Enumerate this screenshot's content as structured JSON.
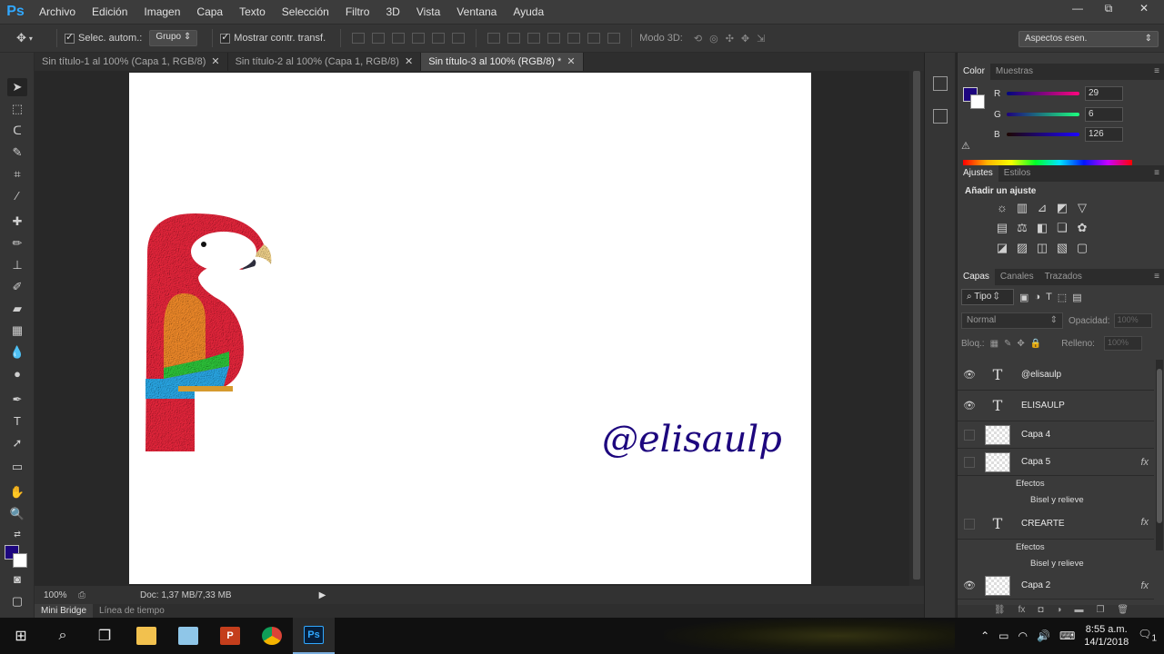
{
  "app": {
    "logo": "Ps"
  },
  "menu": [
    "Archivo",
    "Edición",
    "Imagen",
    "Capa",
    "Texto",
    "Selección",
    "Filtro",
    "3D",
    "Vista",
    "Ventana",
    "Ayuda"
  ],
  "window_controls": {
    "minimize": "—",
    "restore": "⧉",
    "close": "✕"
  },
  "options": {
    "auto_select_label": "Selec. autom.:",
    "auto_select_value": "Grupo",
    "show_transform_label": "Mostrar contr. transf.",
    "mode3d_label": "Modo 3D:",
    "workspace": "Aspectos esen."
  },
  "tabs": [
    {
      "label": "Sin título-1 al 100% (Capa 1, RGB/8)",
      "active": false
    },
    {
      "label": "Sin título-2 al 100% (Capa 1, RGB/8)",
      "active": false
    },
    {
      "label": "Sin título-3 al 100% (RGB/8) *",
      "active": true
    }
  ],
  "canvas": {
    "watermark_text": "@elisaulp",
    "text_color": "#1d067e"
  },
  "status": {
    "zoom": "100%",
    "doc_info": "Doc: 1,37 MB/7,33 MB"
  },
  "bottom_tabs": [
    "Mini Bridge",
    "Línea de tiempo"
  ],
  "color_panel": {
    "tabs": [
      "Color",
      "Muestras"
    ],
    "foreground": "#1d067e",
    "channels": [
      {
        "label": "R",
        "value": "29"
      },
      {
        "label": "G",
        "value": "6"
      },
      {
        "label": "B",
        "value": "126"
      }
    ]
  },
  "adjustments_panel": {
    "tabs": [
      "Ajustes",
      "Estilos"
    ],
    "title": "Añadir un ajuste"
  },
  "layers_panel": {
    "tabs": [
      "Capas",
      "Canales",
      "Trazados"
    ],
    "kind_filter": "Tipo",
    "blend_mode": "Normal",
    "opacity_label": "Opacidad:",
    "opacity_value": "100%",
    "lock_label": "Bloq.:",
    "fill_label": "Relleno:",
    "fill_value": "100%",
    "layers": [
      {
        "name": "@elisaulp",
        "type": "text",
        "visible": true
      },
      {
        "name": "ELISAULP",
        "type": "text",
        "visible": true
      },
      {
        "name": "Capa 4",
        "type": "image",
        "visible": false
      },
      {
        "name": "Capa 5",
        "type": "image",
        "visible": false,
        "fx": true,
        "effects_label": "Efectos",
        "effect": "Bisel y relieve"
      },
      {
        "name": "CREARTE",
        "type": "text",
        "visible": false,
        "fx": true,
        "effects_label": "Efectos",
        "effect": "Bisel y relieve"
      },
      {
        "name": "Capa 2",
        "type": "image",
        "visible": true,
        "fx": true
      }
    ],
    "fx_label": "fx"
  },
  "taskbar": {
    "time": "8:55 a.m.",
    "date": "14/1/2018",
    "notification_count": "1"
  }
}
